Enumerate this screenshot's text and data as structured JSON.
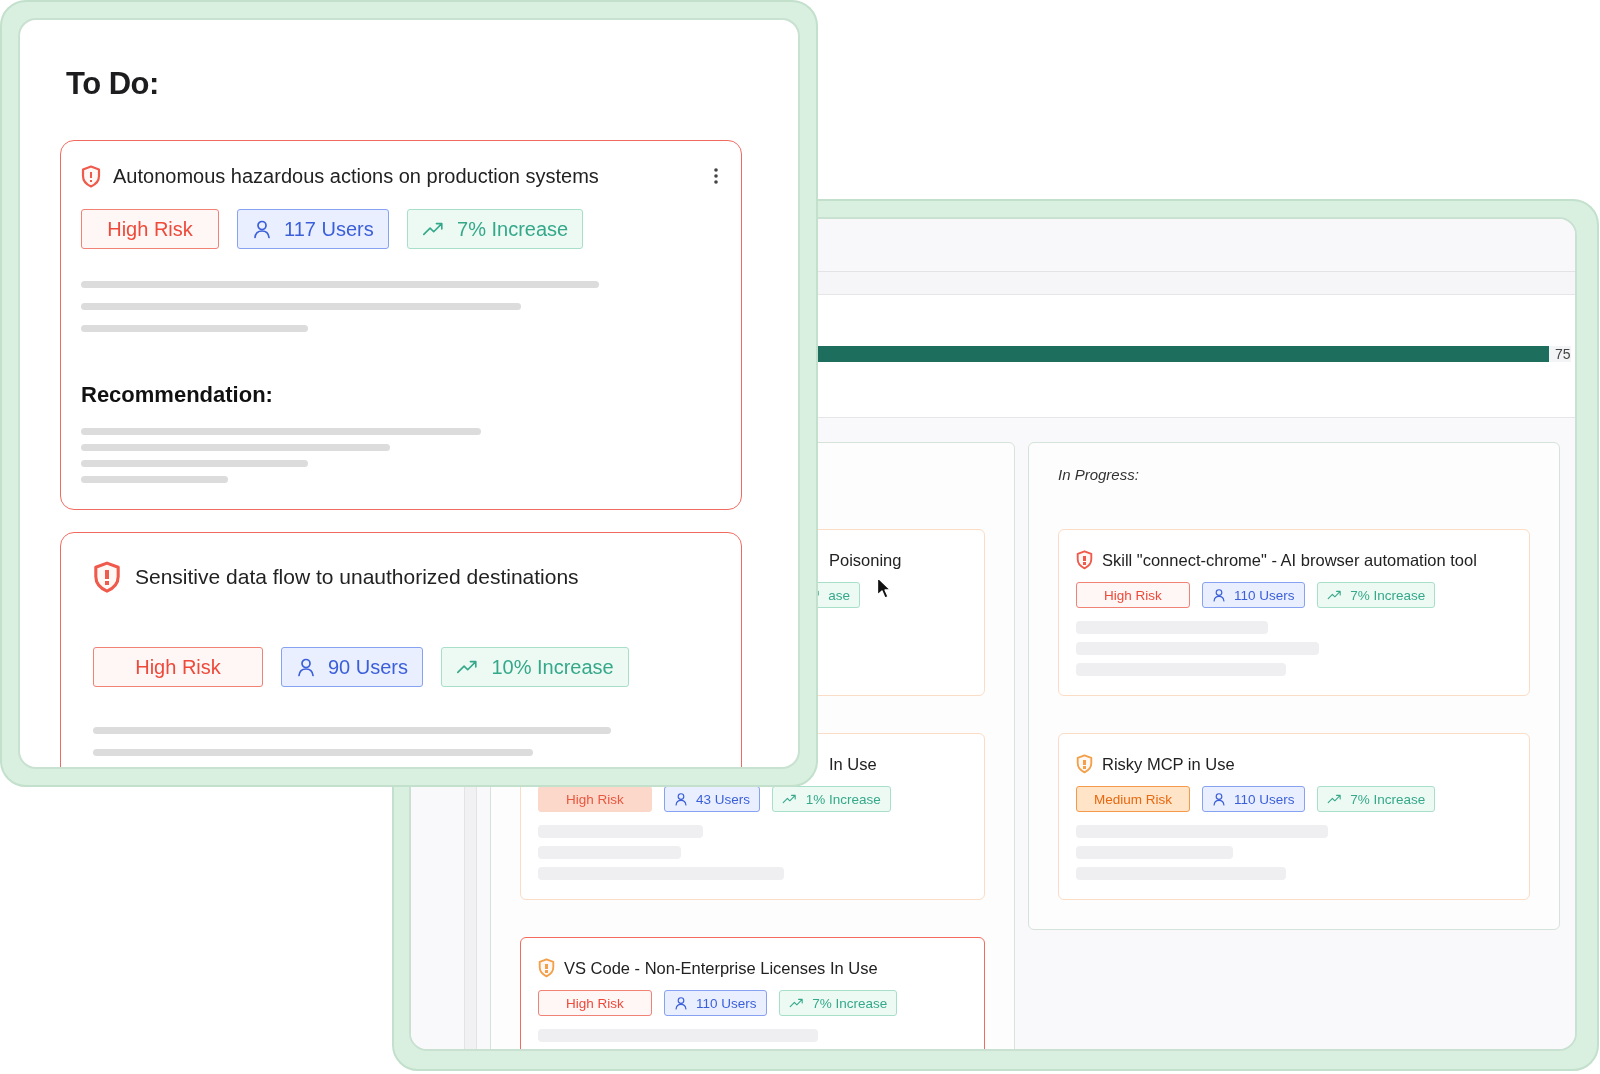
{
  "todo_window": {
    "title": "To Do:",
    "cards": [
      {
        "kind": "compact",
        "title": "Autonomous hazardous actions on production systems",
        "color": "#ef5a4c",
        "menu": true,
        "badges": [
          {
            "kind": "high-risk",
            "label": "High Risk",
            "filled": false
          },
          {
            "kind": "users",
            "label": "117 Users"
          },
          {
            "kind": "trend",
            "label": "7% Increase"
          }
        ],
        "section_label": "Recommendation:"
      },
      {
        "kind": "spacious",
        "title": "Sensitive data flow to unauthorized destinations",
        "color": "#ef5a4c",
        "menu": false,
        "badges": [
          {
            "kind": "high-risk",
            "label": "High Risk",
            "filled": false
          },
          {
            "kind": "users",
            "label": "90 Users"
          },
          {
            "kind": "trend",
            "label": "10% Increase"
          }
        ]
      }
    ]
  },
  "board_window": {
    "progress": {
      "level": 0.98,
      "reading": "75"
    },
    "columns": [
      {
        "cards": [
          {
            "kind": "covered",
            "title": "Poisoning",
            "highlighted": false,
            "badges": [
              {
                "kind": "trend",
                "label": "ase"
              }
            ]
          },
          {
            "kind": "partly-covered",
            "title": "In Use",
            "highlighted": false,
            "badges": [
              {
                "kind": "high-risk",
                "label": "High Risk",
                "filled": true
              },
              {
                "kind": "users",
                "label": "43 Users"
              },
              {
                "kind": "trend",
                "label": "1% Increase"
              }
            ]
          },
          {
            "kind": "full",
            "title": "VS Code - Non-Enterprise Licenses In Use",
            "color": "#f3a04a",
            "highlighted": true,
            "badges": [
              {
                "kind": "high-risk",
                "label": "High Risk",
                "filled": false
              },
              {
                "kind": "users",
                "label": "110 Users"
              },
              {
                "kind": "trend",
                "label": "7% Increase"
              }
            ]
          }
        ]
      },
      {
        "title": "In Progress:",
        "cards": [
          {
            "kind": "full",
            "title": "Skill \"connect-chrome\" - AI browser automation tool",
            "color": "#ef5a4c",
            "highlighted": false,
            "badges": [
              {
                "kind": "high-risk",
                "label": "High Risk",
                "filled": false
              },
              {
                "kind": "users",
                "label": "110 Users"
              },
              {
                "kind": "trend",
                "label": "7% Increase"
              }
            ]
          },
          {
            "kind": "full",
            "title": "Risky MCP in Use",
            "color": "#f3a04a",
            "highlighted": false,
            "badges": [
              {
                "kind": "medium-risk",
                "label": "Medium Risk",
                "filled": true
              },
              {
                "kind": "users",
                "label": "110 Users"
              },
              {
                "kind": "trend",
                "label": "7% Increase"
              }
            ]
          }
        ]
      }
    ]
  }
}
